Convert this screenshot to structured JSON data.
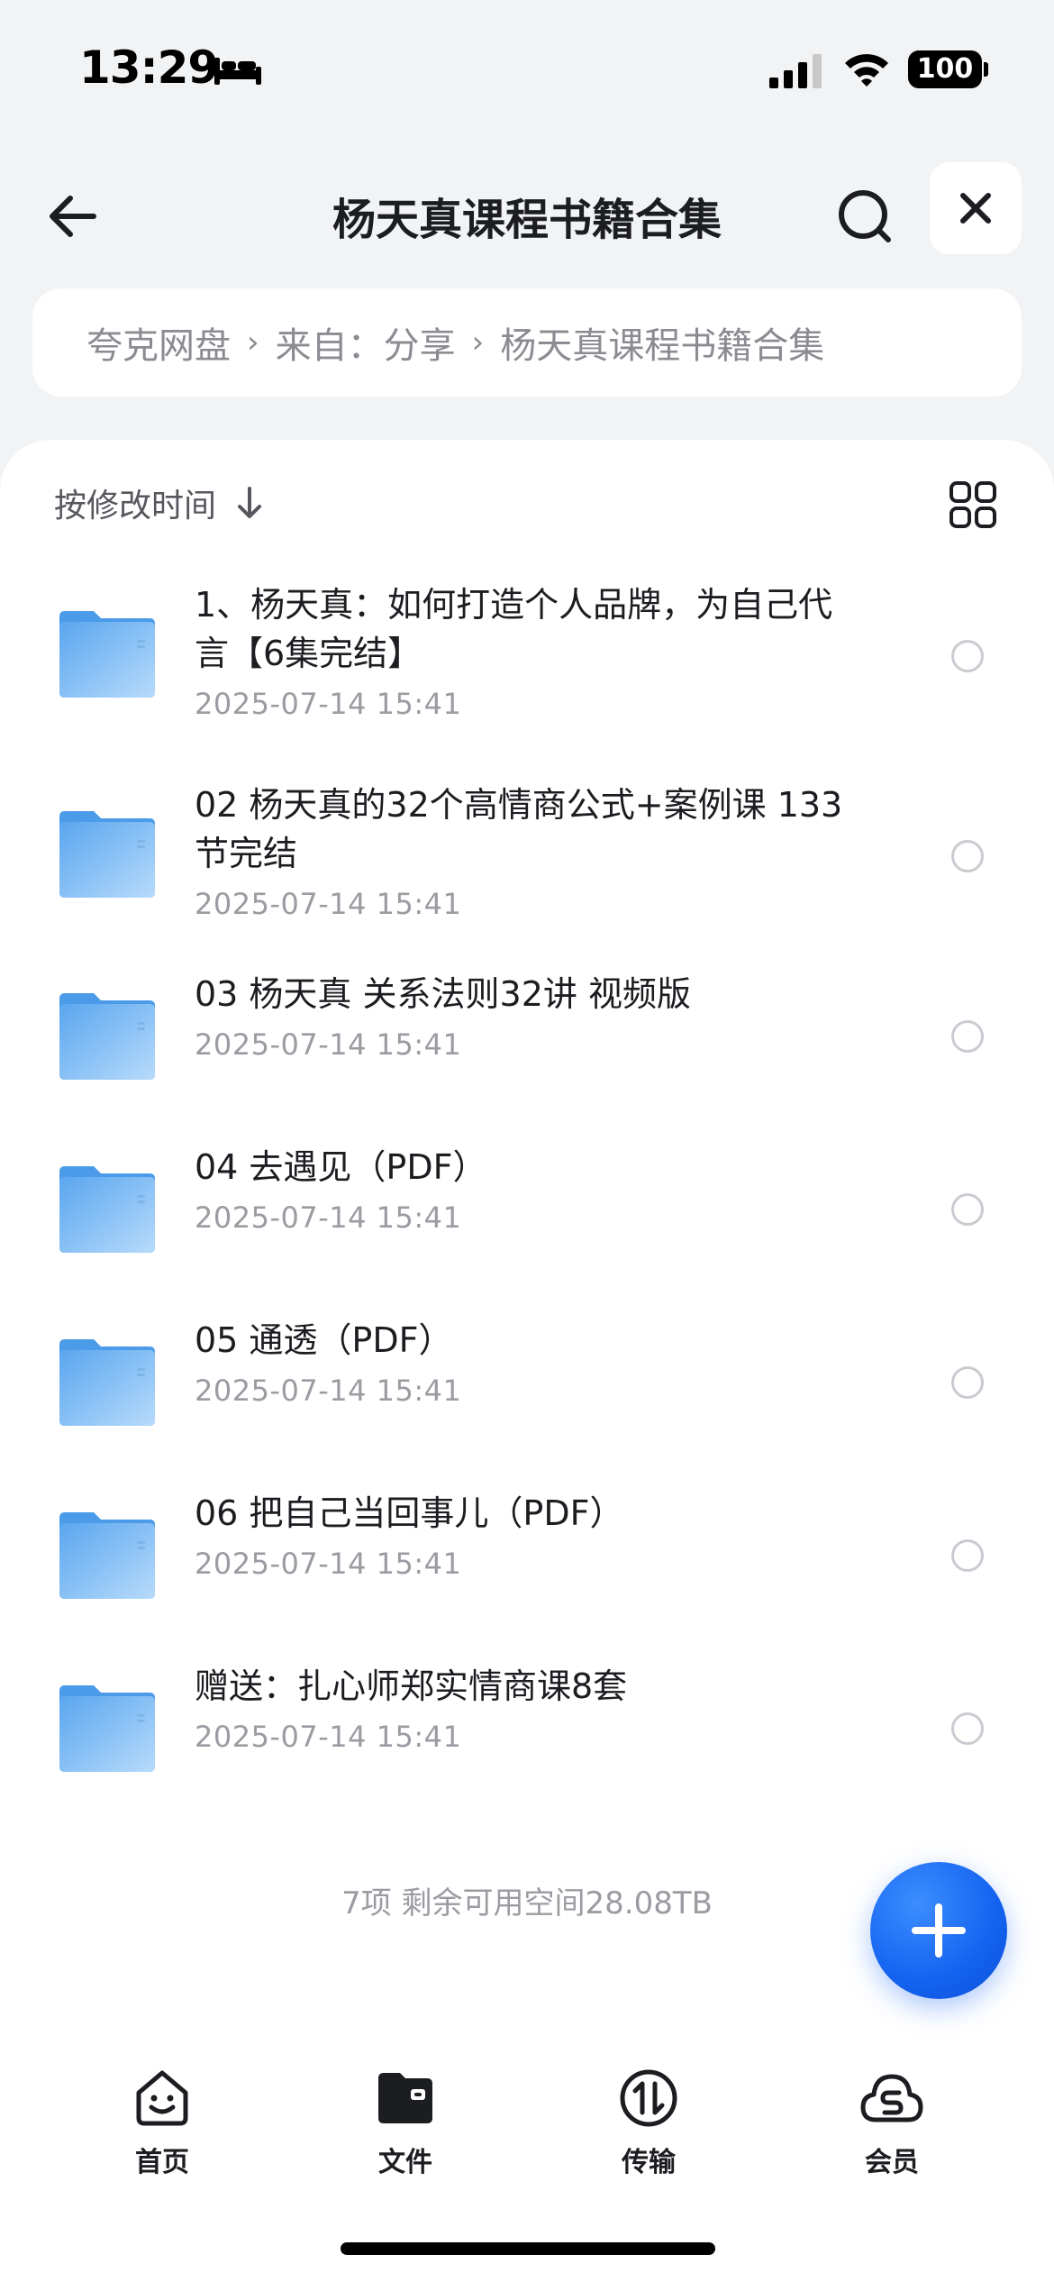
{
  "status_bar": {
    "time": "13:29",
    "battery": "100",
    "icons": [
      "bed-icon",
      "signal-icon",
      "wifi-icon",
      "battery-icon"
    ]
  },
  "header": {
    "title": "杨天真课程书籍合集",
    "icons": [
      "back-arrow-icon",
      "search-icon",
      "close-icon"
    ]
  },
  "breadcrumb": {
    "items": [
      "夸克网盘",
      "来自：分享",
      "杨天真课程书籍合集"
    ],
    "separator": "›"
  },
  "toolbar": {
    "sort_label": "按修改时间",
    "icons": [
      "arrow-down-icon",
      "grid-view-icon"
    ]
  },
  "files": [
    {
      "name": "1、杨天真：如何打造个人品牌，为自己代言【6集完结】",
      "date": "2025-07-14 15:41"
    },
    {
      "name": "02 杨天真的32个高情商公式+案例课 133节完结",
      "date": "2025-07-14 15:41"
    },
    {
      "name": "03 杨天真 关系法则32讲 视频版",
      "date": "2025-07-14 15:41"
    },
    {
      "name": "04 去遇见（PDF）",
      "date": "2025-07-14 15:41"
    },
    {
      "name": "05 通透（PDF）",
      "date": "2025-07-14 15:41"
    },
    {
      "name": "06 把自己当回事儿（PDF）",
      "date": "2025-07-14 15:41"
    },
    {
      "name": "赠送：扎心师郑实情商课8套",
      "date": "2025-07-14 15:41"
    }
  ],
  "footer": {
    "summary": "7项 剩余可用空间28.08TB"
  },
  "fab": {
    "icon": "plus-icon"
  },
  "tabs": [
    {
      "label": "首页",
      "icon": "smiley-home-icon"
    },
    {
      "label": "文件",
      "icon": "folder-file-icon"
    },
    {
      "label": "传输",
      "icon": "transfer-icon"
    },
    {
      "label": "会员",
      "icon": "cloud-member-icon"
    }
  ],
  "colors": {
    "accent": "#1463f0",
    "folder": "#6fb3f4",
    "background": "#f2f3f5"
  }
}
